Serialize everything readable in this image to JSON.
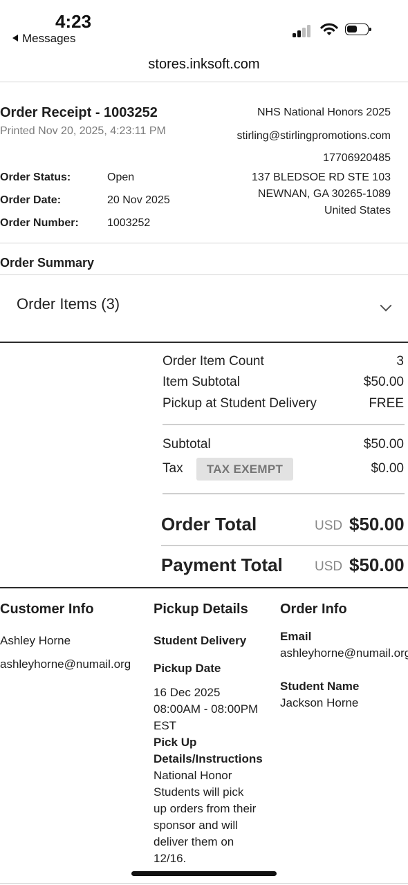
{
  "status_bar": {
    "time": "4:23",
    "back_label": "Messages"
  },
  "browser": {
    "url": "stores.inksoft.com"
  },
  "receipt": {
    "title": "Order Receipt - 1003252",
    "printed": "Printed Nov 20, 2025, 4:23:11 PM",
    "fields": [
      {
        "label": "Order Status:",
        "value": "Open"
      },
      {
        "label": "Order Date:",
        "value": "20 Nov 2025"
      },
      {
        "label": "Order Number:",
        "value": "1003252"
      }
    ]
  },
  "store": {
    "name": "NHS National Honors 2025",
    "email": "stirling@stirlingpromotions.com",
    "phone": "17706920485",
    "address1": "137 BLEDSOE RD STE 103",
    "address2": "NEWNAN, GA 30265-1089",
    "country": "United States"
  },
  "summary": {
    "heading": "Order Summary",
    "items_header": "Order Items (3)",
    "rows": [
      {
        "label": "Order Item Count",
        "value": "3"
      },
      {
        "label": "Item Subtotal",
        "value": "$50.00"
      },
      {
        "label": "Pickup at Student Delivery",
        "value": "FREE"
      }
    ],
    "subtotal": {
      "label": "Subtotal",
      "value": "$50.00"
    },
    "tax": {
      "label": "Tax",
      "badge": "TAX EXEMPT",
      "value": "$0.00"
    },
    "order_total": {
      "label": "Order Total",
      "currency": "USD",
      "value": "$50.00"
    },
    "payment_total": {
      "label": "Payment Total",
      "currency": "USD",
      "value": "$50.00"
    }
  },
  "customer": {
    "heading": "Customer Info",
    "name": "Ashley Horne",
    "email": "ashleyhorne@numail.org"
  },
  "pickup": {
    "heading": "Pickup Details",
    "method": "Student Delivery",
    "date_label": "Pickup Date",
    "date_lines": [
      "16 Dec 2025",
      "08:00AM - 08:00PM",
      "EST"
    ],
    "instructions_label_lines": [
      "Pick Up",
      "Details/Instructions"
    ],
    "instructions_lines": [
      "National Honor",
      "Students will pick",
      "up orders from their",
      "sponsor and will",
      "deliver them on",
      "12/16."
    ]
  },
  "order_info": {
    "heading": "Order Info",
    "email_label": "Email",
    "email": "ashleyhorne@numail.org",
    "student_label": "Student Name",
    "student": "Jackson Horne"
  }
}
